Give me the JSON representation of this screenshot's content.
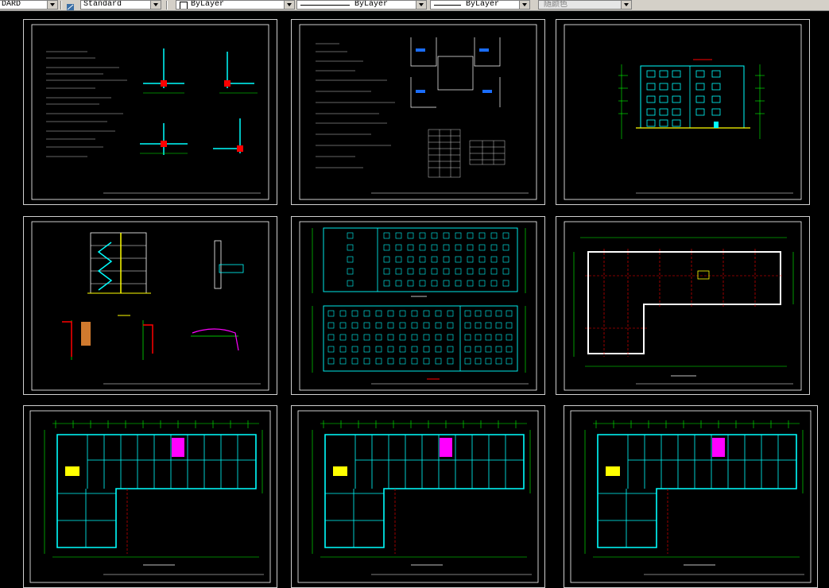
{
  "toolbar": {
    "textstyle_partial": "DARD",
    "dimstyle": "Standard",
    "layer": "ByLayer",
    "linetype_label": "ByLayer",
    "lineweight_label": "ByLayer",
    "plotstyle": "随颜色"
  },
  "colors": {
    "background": "#000000",
    "wall_cyan": "#00ffff",
    "dim_green": "#00ff00",
    "axis_red": "#ff0000",
    "stair_magenta": "#ff00ff",
    "yellow": "#ffff00",
    "frame_white": "#ffffff"
  },
  "sheets": [
    {
      "id": "sheet-1",
      "kind": "details"
    },
    {
      "id": "sheet-2",
      "kind": "notes-and-tables"
    },
    {
      "id": "sheet-3",
      "kind": "side-elevation"
    },
    {
      "id": "sheet-4",
      "kind": "section-and-details"
    },
    {
      "id": "sheet-5",
      "kind": "front-elevations"
    },
    {
      "id": "sheet-6",
      "kind": "roof-plan"
    },
    {
      "id": "sheet-7",
      "kind": "floor-plan"
    },
    {
      "id": "sheet-8",
      "kind": "floor-plan"
    },
    {
      "id": "sheet-9",
      "kind": "floor-plan"
    }
  ]
}
